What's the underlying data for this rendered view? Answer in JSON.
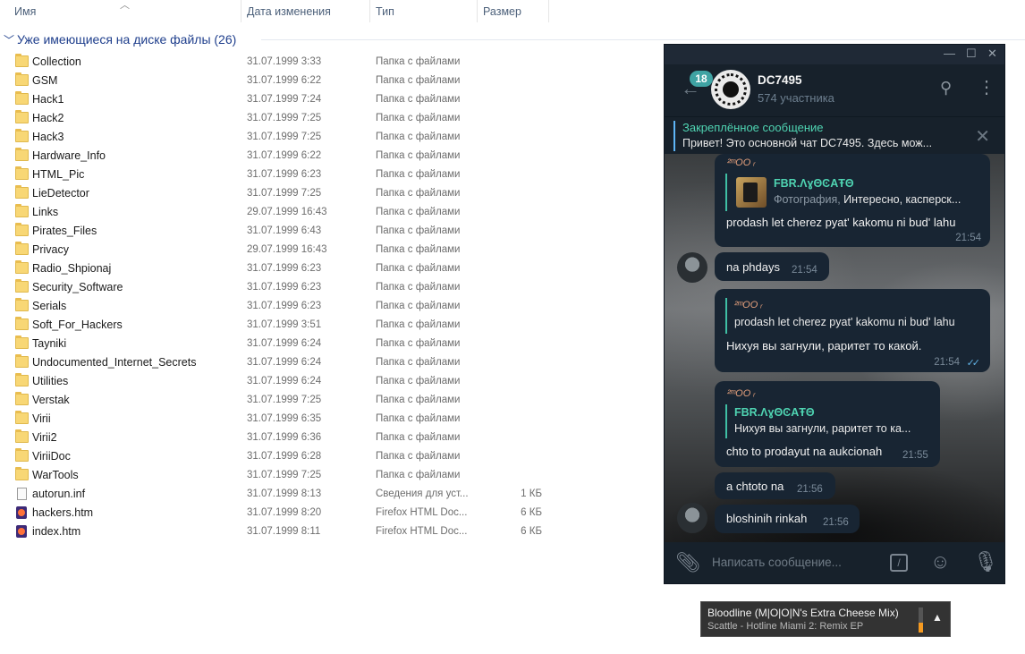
{
  "explorer": {
    "columns": {
      "name": "Имя",
      "date": "Дата изменения",
      "type": "Тип",
      "size": "Размер"
    },
    "group": {
      "chevron": "chevron-down-icon",
      "title": "Уже имеющиеся на диске файлы (26)"
    },
    "items": [
      {
        "name": "Collection",
        "date": "31.07.1999 3:33",
        "type": "Папка с файлами",
        "size": "",
        "icon": "folder"
      },
      {
        "name": "GSM",
        "date": "31.07.1999 6:22",
        "type": "Папка с файлами",
        "size": "",
        "icon": "folder"
      },
      {
        "name": "Hack1",
        "date": "31.07.1999 7:24",
        "type": "Папка с файлами",
        "size": "",
        "icon": "folder"
      },
      {
        "name": "Hack2",
        "date": "31.07.1999 7:25",
        "type": "Папка с файлами",
        "size": "",
        "icon": "folder"
      },
      {
        "name": "Hack3",
        "date": "31.07.1999 7:25",
        "type": "Папка с файлами",
        "size": "",
        "icon": "folder"
      },
      {
        "name": "Hardware_Info",
        "date": "31.07.1999 6:22",
        "type": "Папка с файлами",
        "size": "",
        "icon": "folder"
      },
      {
        "name": "HTML_Pic",
        "date": "31.07.1999 6:23",
        "type": "Папка с файлами",
        "size": "",
        "icon": "folder"
      },
      {
        "name": "LieDetector",
        "date": "31.07.1999 7:25",
        "type": "Папка с файлами",
        "size": "",
        "icon": "folder"
      },
      {
        "name": "Links",
        "date": "29.07.1999 16:43",
        "type": "Папка с файлами",
        "size": "",
        "icon": "folder"
      },
      {
        "name": "Pirates_Files",
        "date": "31.07.1999 6:43",
        "type": "Папка с файлами",
        "size": "",
        "icon": "folder"
      },
      {
        "name": "Privacy",
        "date": "29.07.1999 16:43",
        "type": "Папка с файлами",
        "size": "",
        "icon": "folder"
      },
      {
        "name": "Radio_Shpionaj",
        "date": "31.07.1999 6:23",
        "type": "Папка с файлами",
        "size": "",
        "icon": "folder"
      },
      {
        "name": "Security_Software",
        "date": "31.07.1999 6:23",
        "type": "Папка с файлами",
        "size": "",
        "icon": "folder"
      },
      {
        "name": "Serials",
        "date": "31.07.1999 6:23",
        "type": "Папка с файлами",
        "size": "",
        "icon": "folder"
      },
      {
        "name": "Soft_For_Hackers",
        "date": "31.07.1999 3:51",
        "type": "Папка с файлами",
        "size": "",
        "icon": "folder"
      },
      {
        "name": "Tayniki",
        "date": "31.07.1999 6:24",
        "type": "Папка с файлами",
        "size": "",
        "icon": "folder"
      },
      {
        "name": "Undocumented_Internet_Secrets",
        "date": "31.07.1999 6:24",
        "type": "Папка с файлами",
        "size": "",
        "icon": "folder"
      },
      {
        "name": "Utilities",
        "date": "31.07.1999 6:24",
        "type": "Папка с файлами",
        "size": "",
        "icon": "folder"
      },
      {
        "name": "Verstak",
        "date": "31.07.1999 7:25",
        "type": "Папка с файлами",
        "size": "",
        "icon": "folder"
      },
      {
        "name": "Virii",
        "date": "31.07.1999 6:35",
        "type": "Папка с файлами",
        "size": "",
        "icon": "folder"
      },
      {
        "name": "Virii2",
        "date": "31.07.1999 6:36",
        "type": "Папка с файлами",
        "size": "",
        "icon": "folder"
      },
      {
        "name": "ViriiDoc",
        "date": "31.07.1999 6:28",
        "type": "Папка с файлами",
        "size": "",
        "icon": "folder"
      },
      {
        "name": "WarTools",
        "date": "31.07.1999 7:25",
        "type": "Папка с файлами",
        "size": "",
        "icon": "folder"
      },
      {
        "name": "autorun.inf",
        "date": "31.07.1999 8:13",
        "type": "Сведения для уст...",
        "size": "1 КБ",
        "icon": "file"
      },
      {
        "name": "hackers.htm",
        "date": "31.07.1999 8:20",
        "type": "Firefox HTML Doc...",
        "size": "6 КБ",
        "icon": "firefox"
      },
      {
        "name": "index.htm",
        "date": "31.07.1999 8:11",
        "type": "Firefox HTML Doc...",
        "size": "6 КБ",
        "icon": "firefox"
      }
    ]
  },
  "telegram": {
    "window_buttons": {
      "minimize": "—",
      "maximize": "☐",
      "close": "✕"
    },
    "unread": "18",
    "chat_title": "DC7495",
    "chat_members": "574 участника",
    "pinned": {
      "title": "Закреплённое сообщение",
      "text": "Привет! Это основной чат DC7495.   Здесь мож..."
    },
    "messages": {
      "m1": {
        "sender": "²ᵐOO ᵣ",
        "reply_name": "FBR.ΛɣΘϾΑŦΘ",
        "reply_prefix": "Фотография, ",
        "reply_text": "Интересно, касперск...",
        "text": "prodash let cherez pyat' kakomu ni bud' lahu",
        "time": "21:54"
      },
      "m2": {
        "text": "na phdays",
        "time": "21:54"
      },
      "m3": {
        "reply_name": "²ᵐOO ᵣ",
        "reply_text": "prodash let cherez pyat' kakomu ni bud' lahu",
        "text": "Нихуя вы загнули, раритет то какой.",
        "time": "21:54",
        "ticks": "✓✓"
      },
      "m4": {
        "sender": "²ᵐOO ᵣ",
        "reply_name": "FBR.ΛɣΘϾΑŦΘ",
        "reply_text": "Нихуя вы загнули, раритет то ка...",
        "text": "chto to prodayut na aukcionah",
        "time": "21:55"
      },
      "m5": {
        "text": "a chtoto na",
        "time": "21:56"
      },
      "m6": {
        "text": "bloshinih rinkah",
        "time": "21:56"
      }
    },
    "input_placeholder": "Написать сообщение...",
    "accent": "#4fd4b2"
  },
  "media": {
    "title": "Bloodline (M|O|O|N's Extra Cheese Mix)",
    "subtitle": "Scattle - Hotline Miami 2: Remix EP",
    "volume_level": 0.4,
    "accent": "#f59a21"
  }
}
